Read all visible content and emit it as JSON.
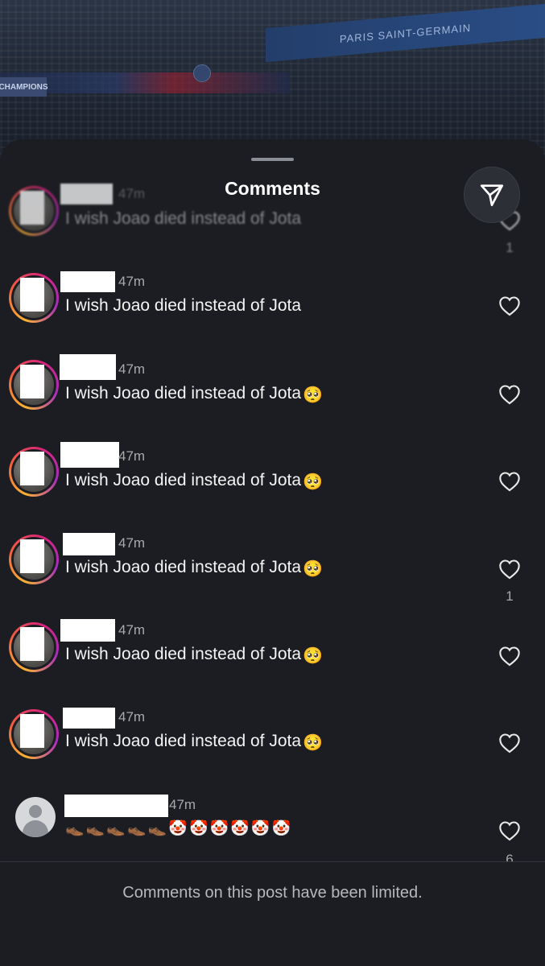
{
  "background": {
    "banner_text": "PARIS SAINT-GERMAIN",
    "badge_text": "CHAMPIONS"
  },
  "sheet": {
    "title": "Comments",
    "share_icon": "paper-plane-icon"
  },
  "comments": [
    {
      "time": "47m",
      "text": "I wish Joao died instead of Jota",
      "emoji": "",
      "likes": "1",
      "liked_icon": "heart-outline-icon"
    },
    {
      "time": "47m",
      "text": "I wish Joao died instead of Jota",
      "emoji": "",
      "likes": "",
      "liked_icon": "heart-outline-icon"
    },
    {
      "time": "47m",
      "text": "I wish Joao died instead of Jota",
      "emoji": "🥺",
      "likes": "",
      "liked_icon": "heart-outline-icon"
    },
    {
      "time": "47m",
      "text": "I wish Joao died instead of Jota",
      "emoji": "🥺",
      "likes": "",
      "liked_icon": "heart-outline-icon"
    },
    {
      "time": "47m",
      "text": "I wish Joao died instead of Jota",
      "emoji": "🥺",
      "likes": "1",
      "liked_icon": "heart-outline-icon"
    },
    {
      "time": "47m",
      "text": "I wish Joao died instead of Jota",
      "emoji": "🥺",
      "likes": "",
      "liked_icon": "heart-outline-icon"
    },
    {
      "time": "47m",
      "text": "I wish Joao died instead of Jota",
      "emoji": "🥺",
      "likes": "",
      "liked_icon": "heart-outline-icon"
    },
    {
      "time": "47m",
      "text": "👞👞👞👞👞🤡🤡🤡🤡🤡🤡",
      "emoji": "",
      "likes": "6",
      "liked_icon": "heart-outline-icon"
    }
  ],
  "footer": {
    "message": "Comments on this post have been limited."
  }
}
